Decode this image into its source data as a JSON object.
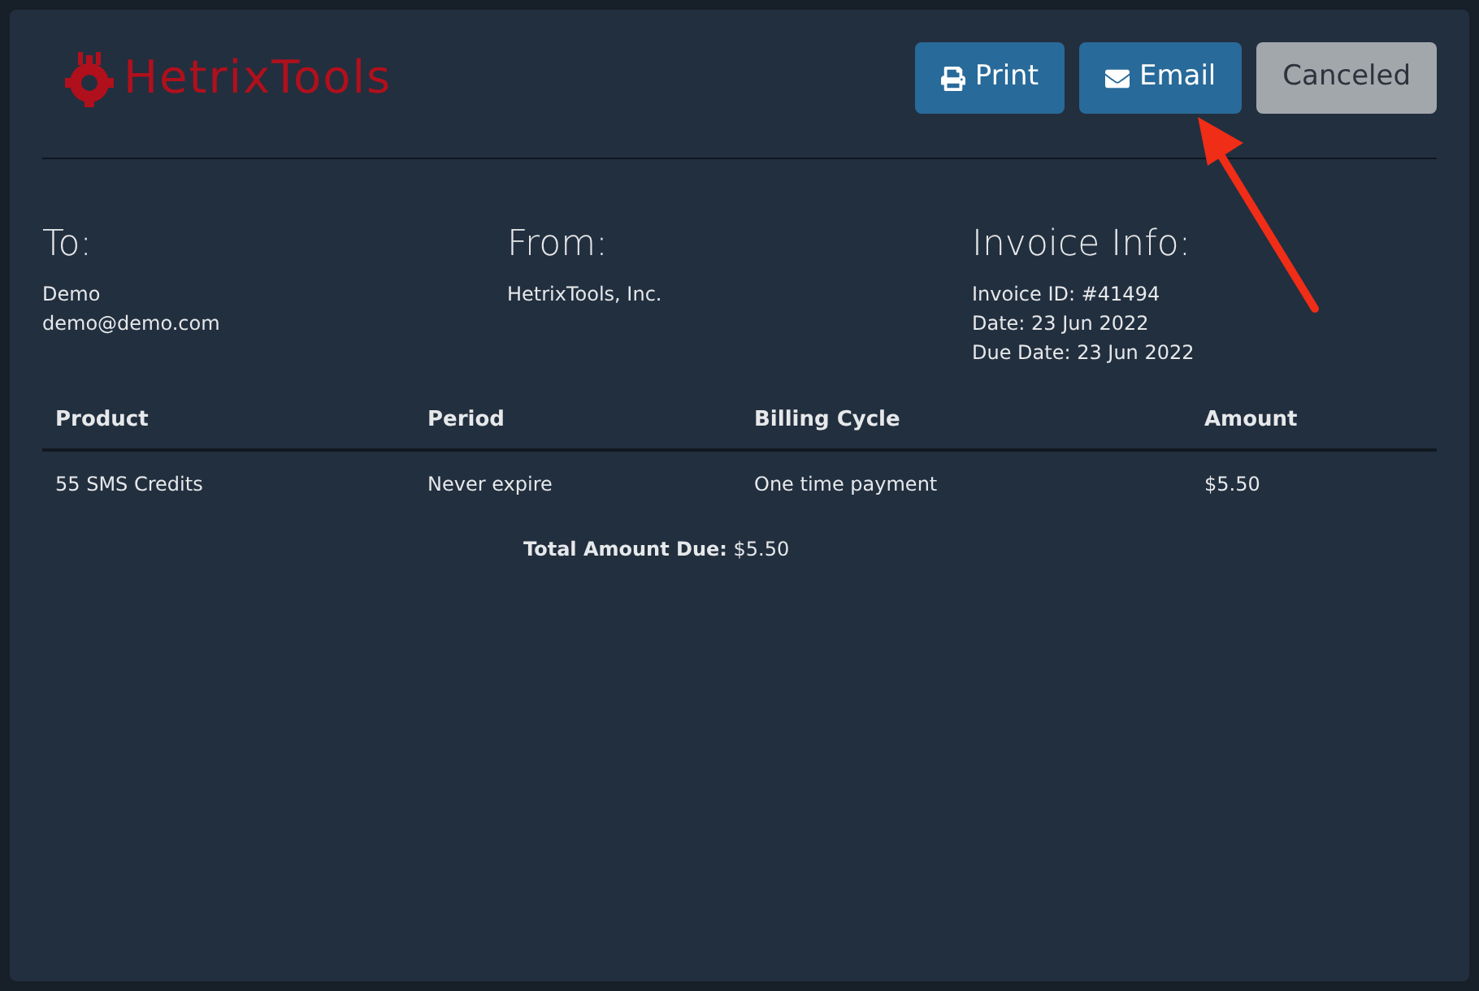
{
  "logo": {
    "text": "HetrixTools"
  },
  "actions": [
    {
      "label": "Print",
      "kind": "print"
    },
    {
      "label": "Email",
      "kind": "email"
    },
    {
      "label": "Canceled",
      "kind": "status"
    }
  ],
  "parties": [
    {
      "heading": "To:",
      "lines": [
        "Demo",
        "demo@demo.com"
      ]
    },
    {
      "heading": "From:",
      "lines": [
        "HetrixTools, Inc."
      ]
    },
    {
      "heading": "Invoice Info:",
      "lines": [
        "Invoice ID: #41494",
        "Date: 23 Jun 2022",
        "Due Date: 23 Jun 2022"
      ]
    }
  ],
  "table": {
    "columns": [
      "Product",
      "Period",
      "Billing Cycle",
      "Amount"
    ],
    "rows": [
      [
        "55 SMS Credits",
        "Never expire",
        "One time payment",
        "$5.50"
      ]
    ]
  },
  "total": "**Total Amount Due:** $5.50"
}
